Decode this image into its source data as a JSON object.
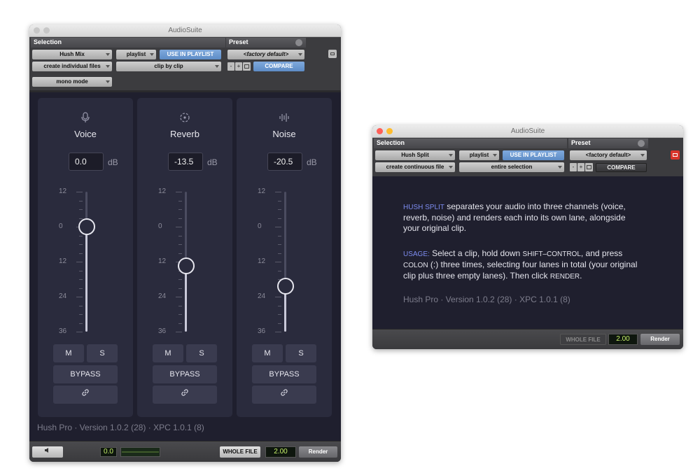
{
  "left": {
    "title": "AudioSuite",
    "selection_label": "Selection",
    "preset_label": "Preset",
    "plugin_dropdown": "Hush Mix",
    "playlist_dropdown": "playlist",
    "use_in_playlist": "USE IN PLAYLIST",
    "preset_value": "<factory default>",
    "file_mode_dropdown": "create individual files",
    "clip_mode_dropdown": "clip by clip",
    "preset_minus": "-",
    "preset_plus": "+",
    "compare": "COMPARE",
    "channel_mode_dropdown": "mono mode",
    "strips": [
      {
        "name": "Voice",
        "db": "0.0",
        "unit": "dB",
        "level_db": 0,
        "mute": "M",
        "solo": "S",
        "bypass": "BYPASS"
      },
      {
        "name": "Reverb",
        "db": "-13.5",
        "unit": "dB",
        "level_db": -13.5,
        "mute": "M",
        "solo": "S",
        "bypass": "BYPASS"
      },
      {
        "name": "Noise",
        "db": "-20.5",
        "unit": "dB",
        "level_db": -20.5,
        "mute": "M",
        "solo": "S",
        "bypass": "BYPASS"
      }
    ],
    "fader_ticks": [
      "12",
      "0",
      "12",
      "24",
      "36"
    ],
    "version": "Hush Pro · Version 1.0.2 (28) · XPC 1.0.1 (8)",
    "meter_value": "0.0",
    "whole_file": "WHOLE FILE",
    "handle_value": "2.00",
    "render": "Render"
  },
  "right": {
    "title": "AudioSuite",
    "selection_label": "Selection",
    "preset_label": "Preset",
    "plugin_dropdown": "Hush Split",
    "playlist_dropdown": "playlist",
    "use_in_playlist": "USE IN PLAYLIST",
    "preset_value": "<factory default>",
    "file_mode_dropdown": "create continuous file",
    "range_dropdown": "entire selection",
    "preset_minus": "-",
    "preset_plus": "+",
    "compare": "COMPARE",
    "p1_kw": "HUSH SPLIT",
    "p1_a": " separates your audio into three channels (voice,",
    "p1_b": "reverb, noise) and renders each into its own lane, alongside",
    "p1_c": "your original clip.",
    "p2_kw": "USAGE:",
    "p2_a1": " Select a clip, hold down ",
    "p2_a_key": "SHIFT–CONTROL",
    "p2_a2": ", and press",
    "p2_b_key": "COLON",
    "p2_b": " (:) three times, selecting four lanes in total (your original",
    "p2_c1": "clip plus three empty lanes). Then click ",
    "p2_c_key": "RENDER",
    "p2_c2": ".",
    "version": "Hush Pro · Version 1.0.2 (28) · XPC 1.0.1 (8)",
    "whole_file": "WHOLE FILE",
    "handle_value": "2.00",
    "render": "Render"
  },
  "colors": {
    "accent_blue": "#6f9bd6",
    "lcd_green": "#c6f06a",
    "keyword": "#7d8cf0",
    "strip_bg": "#2a2b3d"
  }
}
